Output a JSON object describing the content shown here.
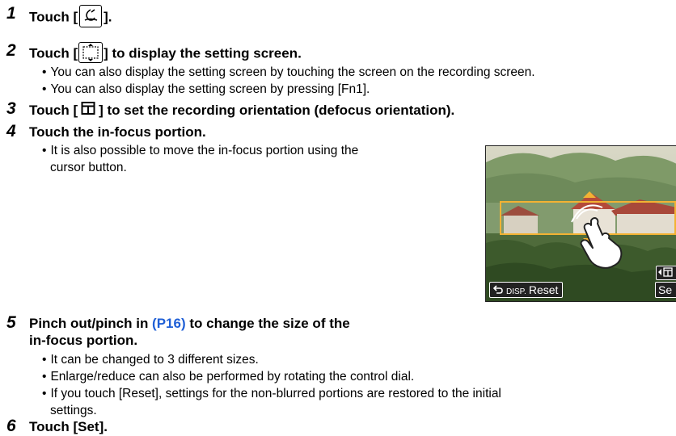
{
  "steps": [
    {
      "number": "1",
      "heading_prefix": "Touch [",
      "icon": "defocus-effect-icon",
      "heading_suffix": "]."
    },
    {
      "number": "2",
      "heading_prefix": "Touch [",
      "icon": "setting-screen-icon",
      "heading_suffix": "] to display the setting screen.",
      "bullets": [
        "You can also display the setting screen by touching the screen on the recording screen.",
        "You can also display the setting screen by pressing [Fn1]."
      ]
    },
    {
      "number": "3",
      "heading_prefix": "Touch [",
      "icon": "orientation-icon",
      "heading_suffix": "] to set the recording orientation (defocus orientation)."
    },
    {
      "number": "4",
      "heading": "Touch the in-focus portion.",
      "bullet_line1": "It is also possible to move the in-focus portion using the",
      "bullet_line2": "cursor button."
    },
    {
      "number": "5",
      "heading_line1_before": "Pinch out/pinch in ",
      "page_ref": "(P16)",
      "heading_line1_after": " to change the size of the",
      "heading_line2": "in-focus portion.",
      "bullets": [
        "It can be changed to 3 different sizes.",
        "Enlarge/reduce can also be performed by rotating the control dial."
      ],
      "bullet3_line1": "If you touch [Reset], settings for the non-blurred portions are restored to the initial",
      "bullet3_line2": "settings."
    },
    {
      "number": "6",
      "heading": "Touch [Set]."
    }
  ],
  "screen": {
    "disp_label": "DISP.",
    "reset_label": "Reset",
    "set_label": "Se",
    "back_icon": "return-arrow-icon",
    "orientation_icon": "orientation-toggle-icon",
    "hand_icon": "touch-hand-icon",
    "accent_color": "#f2b233"
  },
  "bullet_char": "•"
}
